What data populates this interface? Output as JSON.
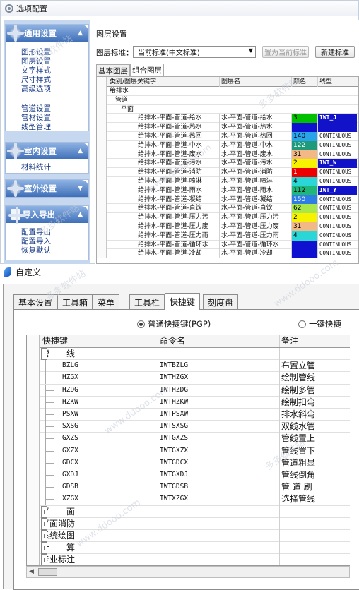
{
  "window1": {
    "title": "选项配置",
    "sidebar": [
      {
        "header": "通用设置",
        "chevron": "▲",
        "items": [
          "图形设置",
          "图层设置",
          "文字样式",
          "尺寸样式",
          "高级选项",
          "管道设置",
          "管材设置",
          "线型管理"
        ]
      },
      {
        "header": "室内设置",
        "chevron": "▲",
        "items": [
          "材料统计"
        ]
      },
      {
        "header": "室外设置",
        "chevron": "▼",
        "items": []
      },
      {
        "header": "导入导出",
        "chevron": "▲",
        "items": [
          "配置导出",
          "配置导入",
          "恢复默认"
        ]
      }
    ],
    "section_title": "图层设置",
    "standard_label": "图层标准：",
    "standard_value": "当前标准(中文标准)",
    "btn_set_current": "置为当前标准",
    "btn_new_standard": "新建标准",
    "tabs": [
      "基本图层",
      "组合图层"
    ],
    "columns": [
      "类别/图层关键字",
      "图层名",
      "颜色",
      "线型"
    ],
    "tree": [
      "给排水",
      "管道",
      "平面"
    ],
    "rows": [
      {
        "key": "给排水-平面-管道-给水",
        "name": "水-平面-管道-给水",
        "color": "3",
        "hex": "#00c000",
        "linetype": "IWT_J",
        "em": true
      },
      {
        "key": "给排水-平面-管道-热水",
        "name": "水-平面-管道-热水",
        "color": "",
        "hex": "#1010d0",
        "linetype": "",
        "em": true
      },
      {
        "key": "给排水-平面-管道-热回",
        "name": "水-平面-管道-热回",
        "color": "140",
        "hex": "#2aa4e8",
        "linetype": "CONTINUOUS",
        "em": false
      },
      {
        "key": "给排水-平面-管道-中水",
        "name": "水-平面-管道-中水",
        "color": "122",
        "hex": "#1f9a7a",
        "linetype": "CONTINUOUS",
        "em": false
      },
      {
        "key": "给排水-平面-管道-废水",
        "name": "水-平面-管道-废水",
        "color": "31",
        "hex": "#f2b987",
        "linetype": "CONTINUOUS",
        "em": false
      },
      {
        "key": "给排水-平面-管道-污水",
        "name": "水-平面-管道-污水",
        "color": "2",
        "hex": "#f6f200",
        "linetype": "IWT_W",
        "em": true
      },
      {
        "key": "给排水-平面-管道-消防",
        "name": "水-平面-管道-消防",
        "color": "1",
        "hex": "#ee0000",
        "linetype": "CONTINUOUS",
        "em": false
      },
      {
        "key": "给排水-平面-管道-喷淋",
        "name": "水-平面-管道-喷淋",
        "color": "4",
        "hex": "#2ad6d6",
        "linetype": "CONTINUOUS",
        "em": false
      },
      {
        "key": "给排水-平面-管道-雨水",
        "name": "水-平面-管道-雨水",
        "color": "112",
        "hex": "#1fb67a",
        "linetype": "IWT_Y",
        "em": true
      },
      {
        "key": "给排水-平面-管道-凝结",
        "name": "水-平面-管道-凝结",
        "color": "150",
        "hex": "#2f7ee6",
        "linetype": "CONTINUOUS",
        "em": false
      },
      {
        "key": "给排水-平面-管道-直饮",
        "name": "水-平面-管道-直饮",
        "color": "62",
        "hex": "#a8e84a",
        "linetype": "CONTINUOUS",
        "em": false
      },
      {
        "key": "给排水-平面-管道-压力污",
        "name": "水-平面-管道-压力污",
        "color": "2",
        "hex": "#f6f200",
        "linetype": "CONTINUOUS",
        "em": false
      },
      {
        "key": "给排水-平面-管道-压力废",
        "name": "水-平面-管道-压力废",
        "color": "31",
        "hex": "#f2b987",
        "linetype": "CONTINUOUS",
        "em": false
      },
      {
        "key": "给排水-平面-管道-压力雨",
        "name": "水-平面-管道-压力雨",
        "color": "4",
        "hex": "#2ad6d6",
        "linetype": "CONTINUOUS",
        "em": false
      },
      {
        "key": "给排水-平面-管道-循环水",
        "name": "水-平面-管道-循环水",
        "color": "",
        "hex": "#1010d0",
        "linetype": "CONTINUOUS",
        "em": false
      },
      {
        "key": "给排水-平面-管道-冷却",
        "name": "水-平面-管道-冷却",
        "color": "",
        "hex": "#1010d0",
        "linetype": "CONTINUOUS",
        "em": false
      }
    ]
  },
  "window2": {
    "title": "自定义",
    "tabs": [
      "基本设置",
      "工具箱",
      "菜单",
      "工具栏",
      "快捷键",
      "刻度盘"
    ],
    "radio_normal": "普通快捷键(PGP)",
    "radio_onekey": "一键快捷",
    "columns": [
      "快捷键",
      "命令名",
      "备注"
    ],
    "group_open": "管　　线",
    "rows": [
      {
        "key": "BZLG",
        "cmd": "IWTBZLG",
        "note": "布置立管"
      },
      {
        "key": "HZGX",
        "cmd": "IWTHZGX",
        "note": "绘制管线"
      },
      {
        "key": "HZDG",
        "cmd": "IWTHZDG",
        "note": "绘制多管"
      },
      {
        "key": "HZKW",
        "cmd": "IWTHZKW",
        "note": "绘制扣弯"
      },
      {
        "key": "PSXW",
        "cmd": "IWTPSXW",
        "note": "排水斜弯"
      },
      {
        "key": "SXSG",
        "cmd": "IWTSXSG",
        "note": "双线水管"
      },
      {
        "key": "GXZS",
        "cmd": "IWTGXZS",
        "note": "管线置上"
      },
      {
        "key": "GXZX",
        "cmd": "IWTGXZX",
        "note": "管线置下"
      },
      {
        "key": "GDCX",
        "cmd": "IWTGDCX",
        "note": "管道粗显"
      },
      {
        "key": "GXDJ",
        "cmd": "IWTGXDJ",
        "note": "管线倒角"
      },
      {
        "key": "GDSB",
        "cmd": "IWTGDSB",
        "note": "管 道 刷"
      },
      {
        "key": "XZGX",
        "cmd": "IWTXZGX",
        "note": "选择管线"
      }
    ],
    "groups": [
      "平　　面",
      "平面消防",
      "系统绘图",
      "计　　算",
      "专业标注"
    ]
  }
}
